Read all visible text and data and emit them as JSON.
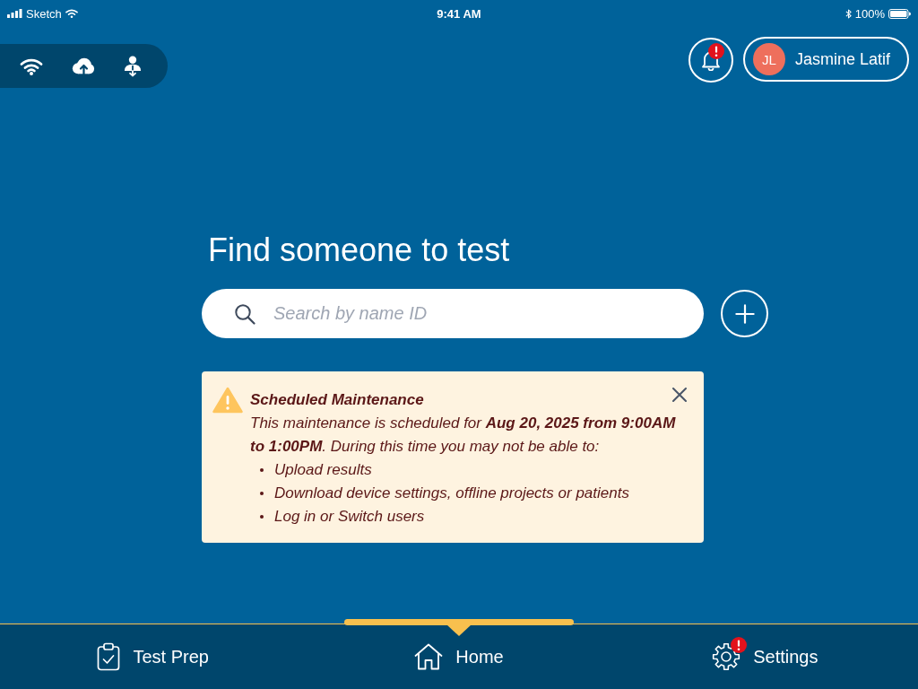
{
  "status_bar": {
    "carrier": "Sketch",
    "time": "9:41 AM",
    "battery": "100%"
  },
  "top_bar": {
    "notifications": {
      "alert": true
    },
    "user": {
      "initials": "JL",
      "name": "Jasmine Latif"
    }
  },
  "main": {
    "heading": "Find someone to test",
    "search": {
      "placeholder": "Search by name ID"
    }
  },
  "notice": {
    "kind": "warning",
    "title": "Scheduled Maintenance",
    "message": "This maintenance is scheduled for **Aug 20, 2025 from 9:00AM to 1:00PM**. During this time you may not be able to:",
    "items": [
      "Upload results",
      "Download device settings, offline projects or patients",
      "Log in or Switch users"
    ],
    "dismissible": true
  },
  "nav": [
    {
      "kind": "clipboard",
      "label": "Test Prep",
      "selected": false,
      "alert": false
    },
    {
      "kind": "home",
      "label": "Home",
      "selected": true,
      "alert": false
    },
    {
      "kind": "gear",
      "label": "Settings",
      "selected": false,
      "alert": true
    }
  ]
}
